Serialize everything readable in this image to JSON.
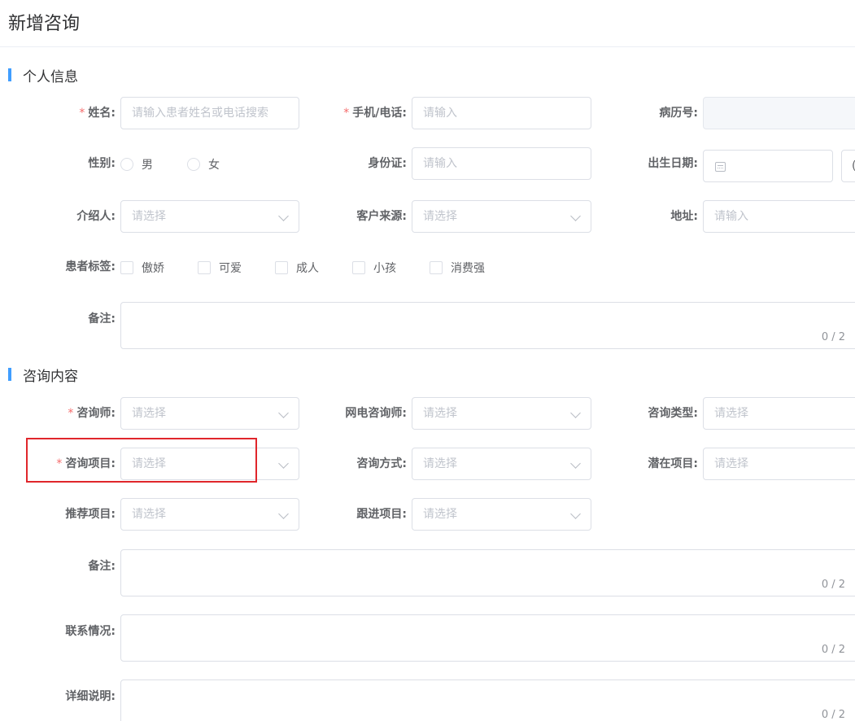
{
  "page_title": "新增咨询",
  "sections": {
    "personal": "个人信息",
    "consult": "咨询内容"
  },
  "personal": {
    "name": {
      "label": "姓名:",
      "placeholder": "请输入患者姓名或电话搜索"
    },
    "phone": {
      "label": "手机/电话:",
      "placeholder": "请输入"
    },
    "record_no": {
      "label": "病历号:"
    },
    "gender": {
      "label": "性别:",
      "options": [
        "男",
        "女"
      ]
    },
    "id_card": {
      "label": "身份证:",
      "placeholder": "请输入"
    },
    "birth": {
      "label": "出生日期:",
      "partial_text": "("
    },
    "referrer": {
      "label": "介绍人:",
      "placeholder": "请选择"
    },
    "source": {
      "label": "客户来源:",
      "placeholder": "请选择"
    },
    "address": {
      "label": "地址:",
      "placeholder": "请输入"
    },
    "tags": {
      "label": "患者标签:",
      "options": [
        "傲娇",
        "可爱",
        "成人",
        "小孩",
        "消费强"
      ]
    },
    "remark": {
      "label": "备注:",
      "count": "0 / 2"
    }
  },
  "consult": {
    "consultant": {
      "label": "咨询师:",
      "placeholder": "请选择"
    },
    "online_consultant": {
      "label": "网电咨询师:",
      "placeholder": "请选择"
    },
    "consult_type": {
      "label": "咨询类型:",
      "placeholder": "请选择"
    },
    "project": {
      "label": "咨询项目:",
      "placeholder": "请选择"
    },
    "method": {
      "label": "咨询方式:",
      "placeholder": "请选择"
    },
    "potential": {
      "label": "潜在项目:",
      "placeholder": "请选择"
    },
    "recommend": {
      "label": "推荐项目:",
      "placeholder": "请选择"
    },
    "followup": {
      "label": "跟进项目:",
      "placeholder": "请选择"
    },
    "remark": {
      "label": "备注:",
      "count": "0 / 2"
    },
    "contact": {
      "label": "联系情况:",
      "count": "0 / 2"
    },
    "detail": {
      "label": "详细说明:",
      "count": "0 / 2"
    }
  },
  "required_mark": "*",
  "colors": {
    "accent": "#409eff",
    "required": "#f56c6c",
    "highlight": "#e0262b"
  }
}
